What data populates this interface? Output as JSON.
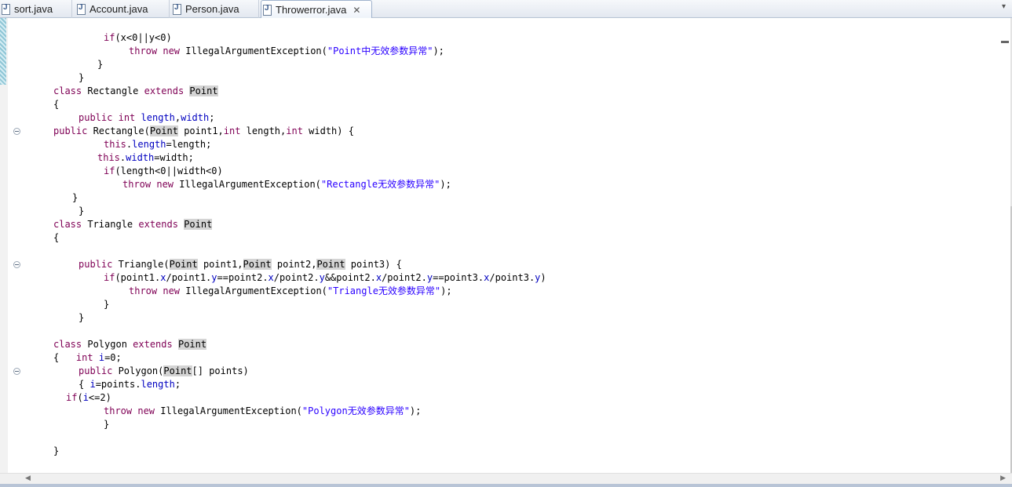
{
  "tabs": [
    {
      "label": "sort.java",
      "icon": "java-file-icon",
      "active": false
    },
    {
      "label": "Account.java",
      "icon": "java-file-icon",
      "active": false
    },
    {
      "label": "Person.java",
      "icon": "java-file-icon",
      "active": false
    },
    {
      "label": "Throwerror.java",
      "icon": "java-file-icon",
      "active": true
    }
  ],
  "icons": {
    "tab_close": "✕",
    "tab_menu": "▾",
    "minimize": "▬",
    "scroll_left": "◀",
    "scroll_right": "▶"
  },
  "colors": {
    "keyword": "#7f0055",
    "field": "#0000c0",
    "string": "#2a00ff",
    "highlight": "#d4d4d4"
  },
  "code_lines": [
    {
      "indent": 132,
      "tokens": [
        [
          "kw",
          "if"
        ],
        [
          "",
          "(x<0||y<0)"
        ]
      ]
    },
    {
      "indent": 164,
      "tokens": [
        [
          "kw",
          "throw"
        ],
        [
          "",
          ""
        ],
        [
          "kw",
          " new"
        ],
        [
          "",
          " IllegalArgumentException("
        ],
        [
          "str",
          "\"Point中无效参数异常\""
        ],
        [
          "",
          ");"
        ]
      ]
    },
    {
      "indent": 124,
      "tokens": [
        [
          "",
          "}"
        ]
      ]
    },
    {
      "indent": 100,
      "tokens": [
        [
          "",
          "}"
        ]
      ]
    },
    {
      "indent": 68,
      "tokens": [
        [
          "kw",
          "class"
        ],
        [
          "",
          " Rectangle "
        ],
        [
          "kw",
          "extends"
        ],
        [
          "",
          " "
        ],
        [
          "hl",
          "Point"
        ]
      ]
    },
    {
      "indent": 68,
      "tokens": [
        [
          "",
          "{"
        ]
      ]
    },
    {
      "indent": 100,
      "tokens": [
        [
          "kw",
          "public"
        ],
        [
          "",
          " "
        ],
        [
          "kw",
          "int"
        ],
        [
          "",
          " "
        ],
        [
          "fld",
          "length"
        ],
        [
          "",
          ","
        ],
        [
          "fld",
          "width"
        ],
        [
          "",
          ";"
        ]
      ]
    },
    {
      "indent": 68,
      "tokens": [
        [
          "kw",
          "public"
        ],
        [
          "",
          " Rectangle("
        ],
        [
          "hl",
          "Point"
        ],
        [
          "",
          " point1,"
        ],
        [
          "kw",
          "int"
        ],
        [
          "",
          " length,"
        ],
        [
          "kw",
          "int"
        ],
        [
          "",
          " width) {"
        ]
      ]
    },
    {
      "indent": 132,
      "tokens": [
        [
          "kw",
          "this"
        ],
        [
          "",
          "."
        ],
        [
          "fld",
          "length"
        ],
        [
          "",
          "=length;"
        ]
      ]
    },
    {
      "indent": 124,
      "tokens": [
        [
          "kw",
          "this"
        ],
        [
          "",
          "."
        ],
        [
          "fld",
          "width"
        ],
        [
          "",
          "=width;"
        ]
      ]
    },
    {
      "indent": 132,
      "tokens": [
        [
          "kw",
          "if"
        ],
        [
          "",
          "(length<0||width<0)"
        ]
      ]
    },
    {
      "indent": 156,
      "tokens": [
        [
          "kw",
          "throw"
        ],
        [
          "",
          " "
        ],
        [
          "kw",
          "new"
        ],
        [
          "",
          " IllegalArgumentException("
        ],
        [
          "str",
          "\"Rectangle无效参数异常\""
        ],
        [
          "",
          ");"
        ]
      ]
    },
    {
      "indent": 92,
      "tokens": [
        [
          "",
          "}"
        ]
      ]
    },
    {
      "indent": 100,
      "tokens": [
        [
          "",
          "}"
        ]
      ]
    },
    {
      "indent": 68,
      "tokens": [
        [
          "kw",
          "class"
        ],
        [
          "",
          " Triangle "
        ],
        [
          "kw",
          "extends"
        ],
        [
          "",
          " "
        ],
        [
          "hl",
          "Point"
        ]
      ]
    },
    {
      "indent": 68,
      "tokens": [
        [
          "",
          "{"
        ]
      ]
    },
    {
      "indent": 68,
      "tokens": [
        [
          "",
          ""
        ]
      ]
    },
    {
      "indent": 100,
      "tokens": [
        [
          "kw",
          "public"
        ],
        [
          "",
          " Triangle("
        ],
        [
          "hl",
          "Point"
        ],
        [
          "",
          " point1,"
        ],
        [
          "hl",
          "Point"
        ],
        [
          "",
          " point2,"
        ],
        [
          "hl",
          "Point"
        ],
        [
          "",
          " point3) {"
        ]
      ]
    },
    {
      "indent": 132,
      "tokens": [
        [
          "kw",
          "if"
        ],
        [
          "",
          "(point1."
        ],
        [
          "fld",
          "x"
        ],
        [
          "",
          "/point1."
        ],
        [
          "fld",
          "y"
        ],
        [
          "",
          "==point2."
        ],
        [
          "fld",
          "x"
        ],
        [
          "",
          "/point2."
        ],
        [
          "fld",
          "y"
        ],
        [
          "",
          "&&point2."
        ],
        [
          "fld",
          "x"
        ],
        [
          "",
          "/point2."
        ],
        [
          "fld",
          "y"
        ],
        [
          "",
          "==point3."
        ],
        [
          "fld",
          "x"
        ],
        [
          "",
          "/point3."
        ],
        [
          "fld",
          "y"
        ],
        [
          "",
          ")"
        ]
      ]
    },
    {
      "indent": 164,
      "tokens": [
        [
          "kw",
          "throw"
        ],
        [
          "",
          " "
        ],
        [
          "kw",
          "new"
        ],
        [
          "",
          " IllegalArgumentException("
        ],
        [
          "str",
          "\"Triangle无效参数异常\""
        ],
        [
          "",
          ");"
        ]
      ]
    },
    {
      "indent": 132,
      "tokens": [
        [
          "",
          "}"
        ]
      ]
    },
    {
      "indent": 100,
      "tokens": [
        [
          "",
          "}"
        ]
      ]
    },
    {
      "indent": 68,
      "tokens": [
        [
          "",
          ""
        ]
      ]
    },
    {
      "indent": 68,
      "tokens": [
        [
          "kw",
          "class"
        ],
        [
          "",
          " Polygon "
        ],
        [
          "kw",
          "extends"
        ],
        [
          "",
          " "
        ],
        [
          "hl",
          "Point"
        ]
      ]
    },
    {
      "indent": 68,
      "tokens": [
        [
          "",
          "{   "
        ],
        [
          "kw",
          "int"
        ],
        [
          "",
          " "
        ],
        [
          "fld",
          "i"
        ],
        [
          "",
          "=0;"
        ]
      ]
    },
    {
      "indent": 100,
      "tokens": [
        [
          "kw",
          "public"
        ],
        [
          "",
          " Polygon("
        ],
        [
          "hl",
          "Point"
        ],
        [
          "",
          "[] points)"
        ]
      ]
    },
    {
      "indent": 100,
      "tokens": [
        [
          "",
          "{ "
        ],
        [
          "fld",
          "i"
        ],
        [
          "",
          "=points."
        ],
        [
          "fld",
          "length"
        ],
        [
          "",
          ";"
        ]
      ]
    },
    {
      "indent": 84,
      "tokens": [
        [
          "kw",
          "if"
        ],
        [
          "",
          "("
        ],
        [
          "fld",
          "i"
        ],
        [
          "",
          "<=2)"
        ]
      ]
    },
    {
      "indent": 132,
      "tokens": [
        [
          "kw",
          "throw"
        ],
        [
          "",
          " "
        ],
        [
          "kw",
          "new"
        ],
        [
          "",
          " IllegalArgumentException("
        ],
        [
          "str",
          "\"Polygon无效参数异常\""
        ],
        [
          "",
          ");"
        ]
      ]
    },
    {
      "indent": 132,
      "tokens": [
        [
          "",
          "}"
        ]
      ]
    },
    {
      "indent": 68,
      "tokens": [
        [
          "",
          ""
        ]
      ]
    },
    {
      "indent": 68,
      "tokens": [
        [
          "",
          "}"
        ]
      ]
    }
  ]
}
